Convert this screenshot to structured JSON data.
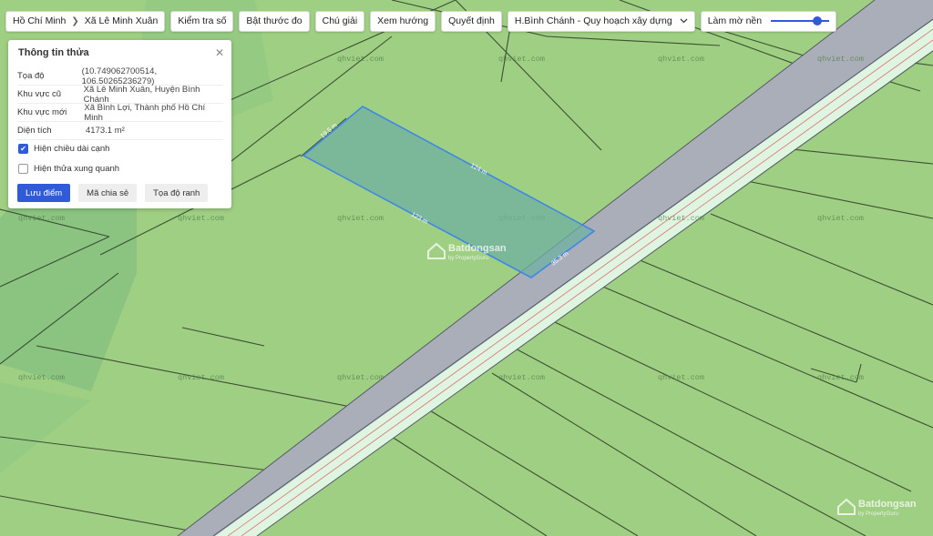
{
  "toolbar": {
    "breadcrumb": {
      "city": "Hồ Chí Minh",
      "ward": "Xã Lê Minh Xuân"
    },
    "buttons": [
      "Kiểm tra số",
      "Bật thước đo",
      "Chú giải",
      "Xem hướng",
      "Quyết định"
    ],
    "layer_select": "H.Bình Chánh - Quy hoạch xây dựng",
    "blur_label": "Làm mờ nền",
    "blur_level": 0.85
  },
  "panel": {
    "title": "Thông tin thửa",
    "rows": [
      {
        "key": "Tọa độ",
        "value": "(10.749062700514, 106.50265236279)"
      },
      {
        "key": "Khu vực cũ",
        "value": "Xã Lê Minh Xuân, Huyện Bình Chánh"
      },
      {
        "key": "Khu vực mới",
        "value": "Xã Bình Lợi, Thành phố Hồ Chí Minh"
      },
      {
        "key": "Diện tích",
        "value": "4173.1 m²"
      }
    ],
    "show_edge_lengths": {
      "label": "Hiện chiều dài cạnh",
      "checked": true
    },
    "show_neighbors": {
      "label": "Hiện thửa xung quanh",
      "checked": false
    },
    "buttons": {
      "save": "Lưu điểm",
      "share": "Mã chia sẻ",
      "coords": "Tọa độ ranh"
    }
  },
  "map": {
    "watermark": "qhviet.com",
    "brand": "Batdongsan",
    "brand_sub": "by PropertyGuru",
    "edge_labels": [
      "19.5 m",
      "124 m",
      "123 m",
      "35.3 m"
    ],
    "colors": {
      "land": "#9fcf83",
      "road": "#a9aeb8",
      "road_light": "#def5e2",
      "parcel": "#3f87e6"
    }
  }
}
